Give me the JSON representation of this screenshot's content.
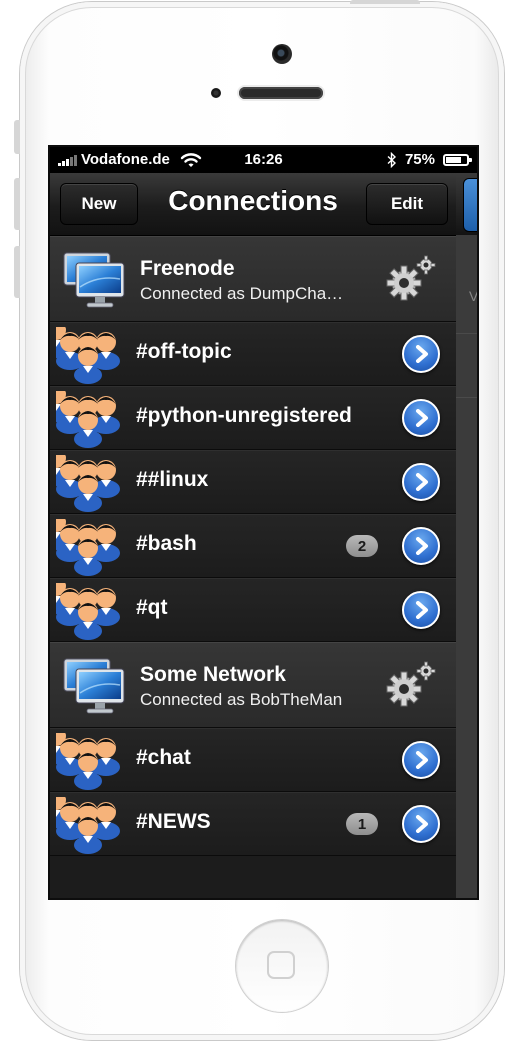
{
  "status_bar": {
    "carrier": "Vodafone.de",
    "time": "16:26",
    "battery_percent": "75%",
    "battery_level": 0.75,
    "signal_bars": 3,
    "icons": [
      "signal-icon",
      "wifi-icon",
      "bluetooth-icon",
      "battery-icon"
    ]
  },
  "nav": {
    "left_button": "New",
    "title": "Connections",
    "right_button": "Edit"
  },
  "networks": [
    {
      "name": "Freenode",
      "status": "Connected as DumpCha…",
      "icon": "monitor-icon",
      "settings_icon": "gear-icon",
      "channels": [
        {
          "name": "#off-topic",
          "badge": ""
        },
        {
          "name": "#python-unregistered",
          "badge": ""
        },
        {
          "name": "##linux",
          "badge": ""
        },
        {
          "name": "#bash",
          "badge": "2"
        },
        {
          "name": "#qt",
          "badge": ""
        }
      ]
    },
    {
      "name": "Some Network",
      "status": "Connected as BobTheMan",
      "icon": "monitor-icon",
      "settings_icon": "gear-icon",
      "channels": [
        {
          "name": "#chat",
          "badge": ""
        },
        {
          "name": "#NEWS",
          "badge": "1"
        }
      ]
    }
  ],
  "peek_panel": {
    "char": "V"
  },
  "colors": {
    "accent_blue": "#2f6fd0",
    "badge_gray": "#a5a5a5",
    "row_bg": "#1f1f1f",
    "server_bg": "#303030",
    "nav_bg": "#1c1c1c"
  }
}
